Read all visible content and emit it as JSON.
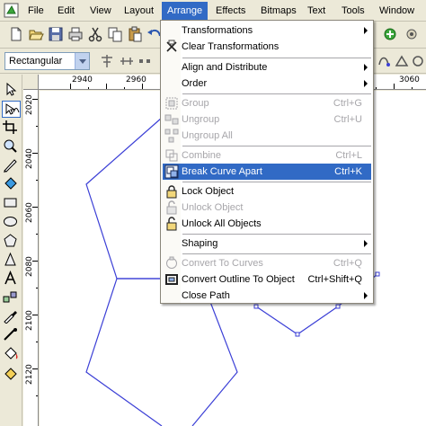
{
  "menubar": {
    "items": [
      "File",
      "Edit",
      "View",
      "Layout",
      "Arrange",
      "Effects",
      "Bitmaps",
      "Text",
      "Tools",
      "Window"
    ],
    "active": "Arrange"
  },
  "propertybar": {
    "shape_select_value": "Rectangular"
  },
  "rulers": {
    "top_labels": [
      "2940",
      "2960",
      "3060"
    ],
    "left_labels": [
      "2020",
      "2040",
      "2060",
      "2080",
      "2100",
      "2120"
    ]
  },
  "arrange_menu": {
    "items": [
      {
        "label": "Transformations",
        "shortcut": "",
        "submenu": true,
        "enabled": true,
        "icon": "none"
      },
      {
        "label": "Clear Transformations",
        "shortcut": "",
        "submenu": false,
        "enabled": true,
        "icon": "clear-transform-icon"
      },
      {
        "label": "Align and Distribute",
        "shortcut": "",
        "submenu": true,
        "enabled": true,
        "icon": "none"
      },
      {
        "label": "Order",
        "shortcut": "",
        "submenu": true,
        "enabled": true,
        "icon": "none"
      },
      {
        "label": "Group",
        "shortcut": "Ctrl+G",
        "submenu": false,
        "enabled": false,
        "icon": "group-icon"
      },
      {
        "label": "Ungroup",
        "shortcut": "Ctrl+U",
        "submenu": false,
        "enabled": false,
        "icon": "ungroup-icon"
      },
      {
        "label": "Ungroup All",
        "shortcut": "",
        "submenu": false,
        "enabled": false,
        "icon": "ungroup-all-icon"
      },
      {
        "label": "Combine",
        "shortcut": "Ctrl+L",
        "submenu": false,
        "enabled": false,
        "icon": "combine-icon"
      },
      {
        "label": "Break Curve Apart",
        "shortcut": "Ctrl+K",
        "submenu": false,
        "enabled": true,
        "highlighted": true,
        "icon": "break-apart-icon"
      },
      {
        "label": "Lock Object",
        "shortcut": "",
        "submenu": false,
        "enabled": true,
        "icon": "lock-icon"
      },
      {
        "label": "Unlock Object",
        "shortcut": "",
        "submenu": false,
        "enabled": false,
        "icon": "unlock-icon"
      },
      {
        "label": "Unlock All Objects",
        "shortcut": "",
        "submenu": false,
        "enabled": true,
        "icon": "unlock-all-icon"
      },
      {
        "label": "Shaping",
        "shortcut": "",
        "submenu": true,
        "enabled": true,
        "icon": "none"
      },
      {
        "label": "Convert To Curves",
        "shortcut": "Ctrl+Q",
        "submenu": false,
        "enabled": false,
        "icon": "convert-curves-icon"
      },
      {
        "label": "Convert Outline To Object",
        "shortcut": "Ctrl+Shift+Q",
        "submenu": false,
        "enabled": true,
        "icon": "convert-outline-icon"
      },
      {
        "label": "Close Path",
        "shortcut": "",
        "submenu": true,
        "enabled": true,
        "icon": "none"
      }
    ]
  },
  "colors": {
    "menu_highlight": "#316ac5",
    "chrome": "#ece9d8",
    "shape_stroke": "#3b3fd6",
    "disabled_text": "#a7a6aa"
  }
}
